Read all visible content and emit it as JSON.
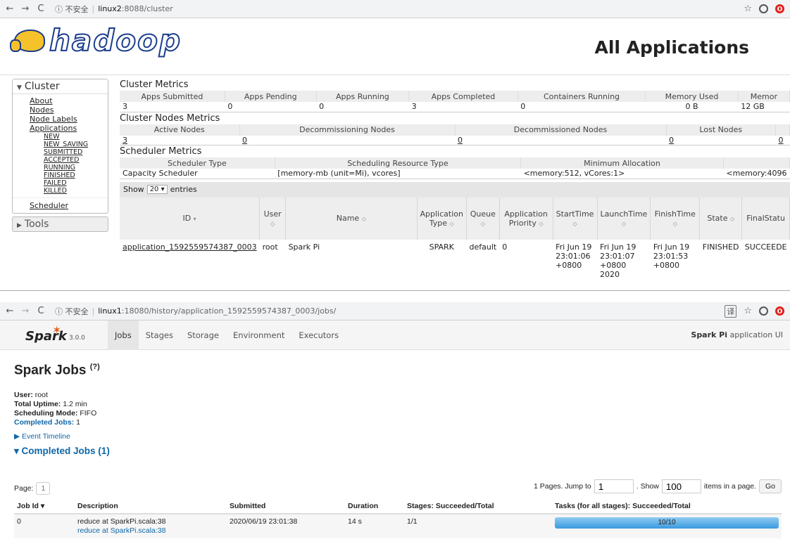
{
  "hadoop": {
    "browser": {
      "security": "不安全",
      "host": "linux2",
      "rest": ":8088/cluster"
    },
    "title": "All Applications",
    "nav": {
      "cluster_label": "Cluster",
      "links": [
        "About",
        "Nodes",
        "Node Labels",
        "Applications"
      ],
      "app_states": [
        "NEW",
        "NEW_SAVING",
        "SUBMITTED",
        "ACCEPTED",
        "RUNNING",
        "FINISHED",
        "FAILED",
        "KILLED"
      ],
      "scheduler": "Scheduler",
      "tools_label": "Tools"
    },
    "cluster_metrics": {
      "title": "Cluster Metrics",
      "headers": [
        "Apps Submitted",
        "Apps Pending",
        "Apps Running",
        "Apps Completed",
        "Containers Running",
        "Memory Used",
        "Memor"
      ],
      "values": [
        "3",
        "0",
        "0",
        "3",
        "0",
        "0 B",
        "12 GB"
      ]
    },
    "node_metrics": {
      "title": "Cluster Nodes Metrics",
      "headers": [
        "Active Nodes",
        "Decommissioning Nodes",
        "Decommissioned Nodes",
        "Lost Nodes"
      ],
      "values": [
        "3",
        "0",
        "0",
        "0",
        "0"
      ]
    },
    "scheduler_metrics": {
      "title": "Scheduler Metrics",
      "headers": [
        "Scheduler Type",
        "Scheduling Resource Type",
        "Minimum Allocation"
      ],
      "values": [
        "Capacity Scheduler",
        "[memory-mb (unit=Mi), vcores]",
        "<memory:512, vCores:1>",
        "<memory:4096"
      ]
    },
    "apps_table": {
      "show_prefix": "Show",
      "show_value": "20",
      "show_suffix": "entries",
      "headers": [
        "ID",
        "User",
        "Name",
        "Application Type",
        "Queue",
        "Application Priority",
        "StartTime",
        "LaunchTime",
        "FinishTime",
        "State",
        "FinalStatu"
      ],
      "row": {
        "id": "application_1592559574387_0003",
        "user": "root",
        "name": "Spark Pi",
        "type": "SPARK",
        "queue": "default",
        "priority": "0",
        "start": "Fri Jun 19 23:01:06 +0800",
        "launch": "Fri Jun 19 23:01:07 +0800 2020",
        "finish": "Fri Jun 19 23:01:53 +0800",
        "state": "FINISHED",
        "final": "SUCCEEDE"
      }
    }
  },
  "spark": {
    "browser": {
      "security": "不安全",
      "host": "linux1",
      "rest": ":18080/history/application_1592559574387_0003/jobs/"
    },
    "version": "3.0.0",
    "logo_text": "Spark",
    "tabs": [
      "Jobs",
      "Stages",
      "Storage",
      "Environment",
      "Executors"
    ],
    "app_name": "Spark Pi",
    "app_ui_suffix": "application UI",
    "heading": "Spark Jobs",
    "heading_help": "(?)",
    "user_label": "User:",
    "user": "root",
    "uptime_label": "Total Uptime:",
    "uptime": "1.2 min",
    "mode_label": "Scheduling Mode:",
    "mode": "FIFO",
    "completed_label": "Completed Jobs:",
    "completed": "1",
    "event_timeline": "Event Timeline",
    "completed_section": "Completed Jobs (1)",
    "pager": {
      "page_label": "Page:",
      "page": "1",
      "jump_text": "1 Pages. Jump to",
      "jump_value": "1",
      "show_text": ". Show",
      "show_value": "100",
      "items_text": "items in a page.",
      "go": "Go"
    },
    "jobs_table": {
      "headers": [
        "Job Id ▾",
        "Description",
        "Submitted",
        "Duration",
        "Stages: Succeeded/Total",
        "Tasks (for all stages): Succeeded/Total"
      ],
      "row": {
        "id": "0",
        "desc": "reduce at SparkPi.scala:38",
        "desc_link": "reduce at SparkPi.scala:38",
        "submitted": "2020/06/19 23:01:38",
        "duration": "14 s",
        "stages": "1/1",
        "tasks": "10/10",
        "tasks_fraction": 1.0
      }
    }
  },
  "colors": {
    "link_blue": "#0f67a8",
    "progress_blue": "#5aaee8",
    "hadoop_blue": "#1a3c8c",
    "spark_orange": "#e25a1c"
  }
}
